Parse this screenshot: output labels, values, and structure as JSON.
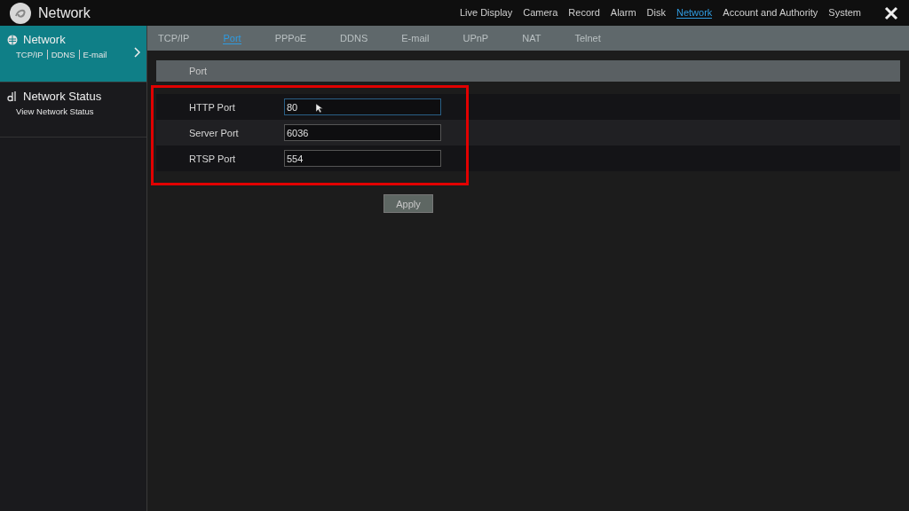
{
  "header": {
    "title": "Network",
    "menu": [
      {
        "label": "Live Display",
        "selected": false
      },
      {
        "label": "Camera",
        "selected": false
      },
      {
        "label": "Record",
        "selected": false
      },
      {
        "label": "Alarm",
        "selected": false
      },
      {
        "label": "Disk",
        "selected": false
      },
      {
        "label": "Network",
        "selected": true
      },
      {
        "label": "Account and Authority",
        "selected": false
      },
      {
        "label": "System",
        "selected": false
      }
    ]
  },
  "sidebar": {
    "items": [
      {
        "kind": "globe",
        "title": "Network",
        "subitems": [
          "TCP/IP",
          "DDNS",
          "E-mail"
        ],
        "selected": true
      },
      {
        "kind": "status",
        "title": "Network Status",
        "subitems": [
          "View Network Status"
        ],
        "selected": false
      }
    ]
  },
  "tabs": [
    {
      "label": "TCP/IP",
      "selected": false
    },
    {
      "label": "Port",
      "selected": true
    },
    {
      "label": "PPPoE",
      "selected": false
    },
    {
      "label": "DDNS",
      "selected": false
    },
    {
      "label": "E-mail",
      "selected": false
    },
    {
      "label": "UPnP",
      "selected": false
    },
    {
      "label": "NAT",
      "selected": false
    },
    {
      "label": "Telnet",
      "selected": false
    }
  ],
  "section": {
    "title": "Port",
    "highlighted": true,
    "fields": [
      {
        "label": "HTTP Port",
        "value": "80",
        "focused": true
      },
      {
        "label": "Server Port",
        "value": "6036",
        "focused": false
      },
      {
        "label": "RTSP Port",
        "value": "554",
        "focused": false
      }
    ]
  },
  "buttons": [
    "Apply"
  ]
}
